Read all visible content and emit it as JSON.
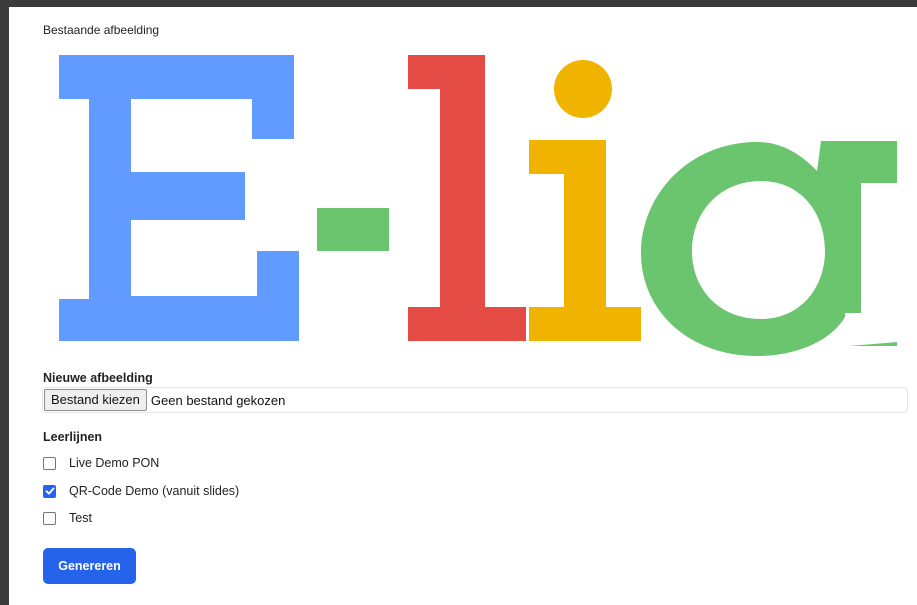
{
  "existing_image": {
    "label": "Bestaande afbeelding",
    "logo_text": "E-lia",
    "logo_colors": {
      "E": "#619bff",
      "dash": "#6bc56e",
      "l": "#e34b44",
      "i": "#f0b400",
      "a": "#6bc56e"
    }
  },
  "new_image": {
    "label": "Nieuwe afbeelding",
    "button_label": "Bestand kiezen",
    "status": "Geen bestand gekozen"
  },
  "tracks": {
    "label": "Leerlijnen",
    "items": [
      {
        "label": "Live Demo PON",
        "checked": false
      },
      {
        "label": "QR-Code Demo (vanuit slides)",
        "checked": true
      },
      {
        "label": "Test",
        "checked": false
      }
    ]
  },
  "actions": {
    "generate_label": "Genereren"
  },
  "colors": {
    "accent": "#2563eb",
    "frame": "#3b3b3b"
  }
}
